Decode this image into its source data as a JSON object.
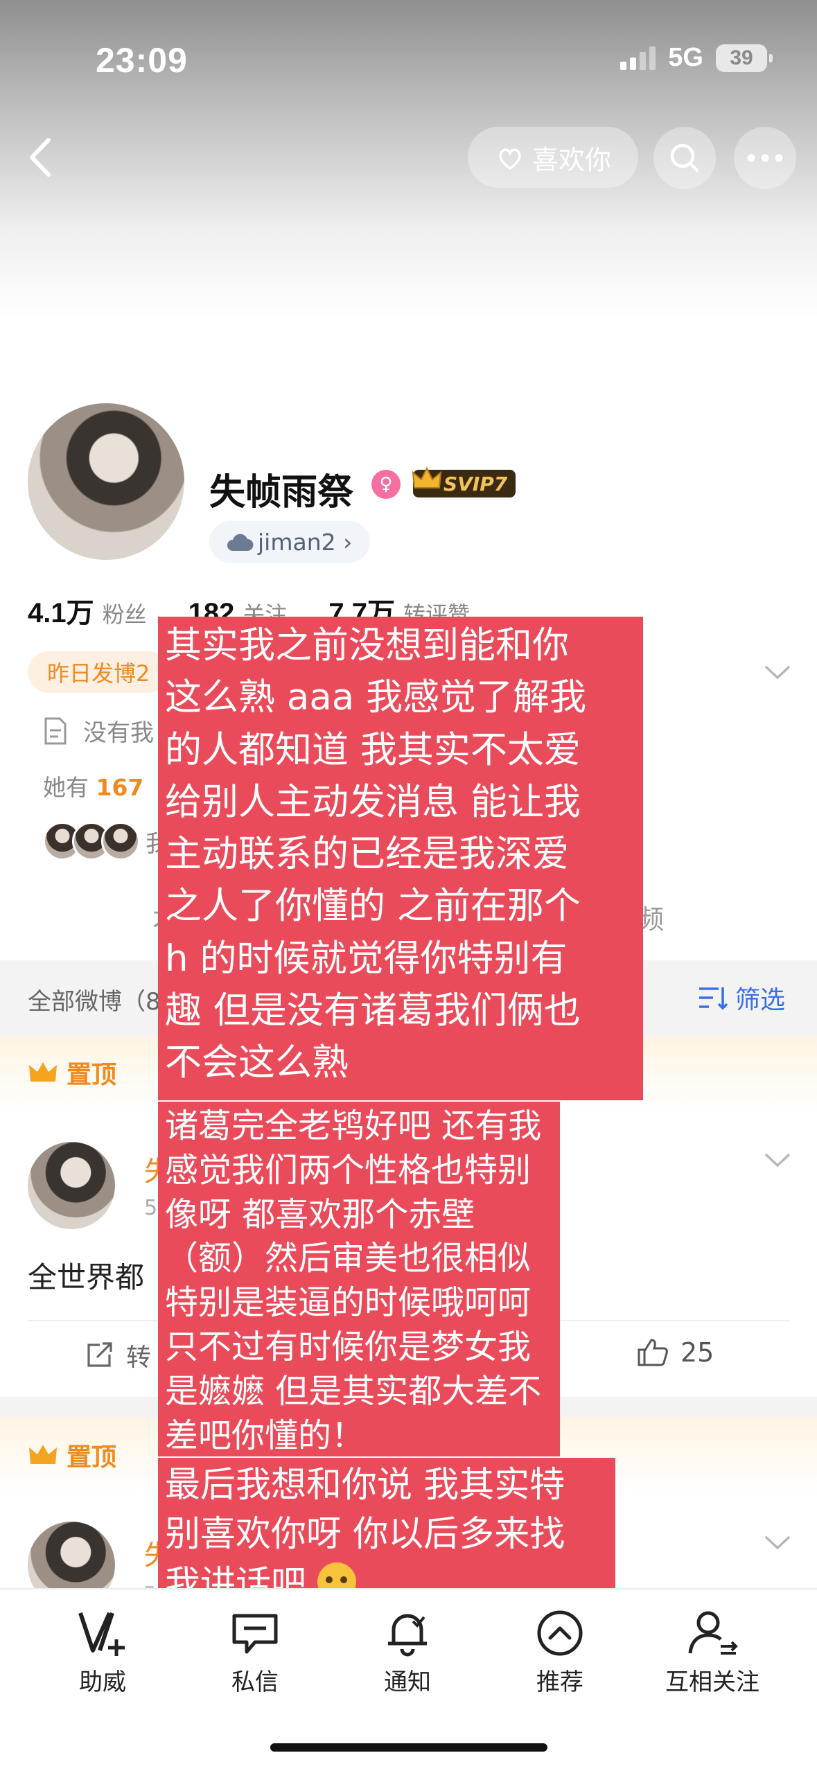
{
  "status_bar": {
    "time": "23:09",
    "network": "5G",
    "battery": "39"
  },
  "header": {
    "like_label": "喜欢你"
  },
  "profile": {
    "name": "失帧雨祭",
    "vip": "SVIP7",
    "weibo_id": "jiman2 ›",
    "stats": [
      {
        "num": "4.1万",
        "label": "粉丝"
      },
      {
        "num": "182",
        "label": "关注"
      },
      {
        "num": "7.7万",
        "label": "转评赞"
      }
    ],
    "yesterday_tag": "昨日发博2",
    "no_info": "没有我",
    "she_has_prefix": "她有",
    "she_has_count": "167",
    "mutual_frag": "我",
    "ta_frag": "才",
    "pin_frag": "频"
  },
  "feed": {
    "title": "全部微博（8",
    "filter_label": "筛选",
    "pinned_label": "置顶",
    "post1": {
      "name_frag": "失",
      "time_frag": "5",
      "text": "全世界都",
      "repost_frag": "转",
      "likes": "25"
    },
    "post2": {
      "name_frag": "失",
      "time_frag": "–"
    }
  },
  "message_blocks": [
    {
      "lines": [
        "其实我之前没想到能和你",
        "这么熟 aaa 我感觉了解我",
        "的人都知道 我其实不太爱",
        "给别人主动发消息 能让我",
        "主动联系的已经是我深爱",
        "之人了你懂的 之前在那个",
        "h 的时候就觉得你特别有",
        "趣 但是没有诸葛我们俩也",
        "不会这么熟"
      ]
    },
    {
      "lines": [
        "诸葛完全老鸨好吧 还有我",
        "感觉我们两个性格也特别",
        "像呀 都喜欢那个赤壁",
        "（额）然后审美也很相似",
        "特别是装逼的时候哦呵呵",
        "只不过有时候你是梦女我",
        "是嬷嬷 但是其实都大差不",
        "差吧你懂的！"
      ]
    },
    {
      "lines": [
        "最后我想和你说 我其实特",
        "别喜欢你呀 你以后多来找",
        "我讲话吧"
      ],
      "trailing_emoji": "face-with-open-eyes-and-hand-over-mouth"
    }
  ],
  "tabbar": {
    "tabs": [
      {
        "label": "助威",
        "icon": "v-plus-icon"
      },
      {
        "label": "私信",
        "icon": "message-icon"
      },
      {
        "label": "通知",
        "icon": "bell-icon"
      },
      {
        "label": "推荐",
        "icon": "chevron-up-circle-icon"
      },
      {
        "label": "互相关注",
        "icon": "user-follow-icon"
      }
    ]
  },
  "colors": {
    "overlay_red": "#e94b5a",
    "accent_orange": "#f08a1e",
    "link_blue": "#3a6ee8"
  }
}
